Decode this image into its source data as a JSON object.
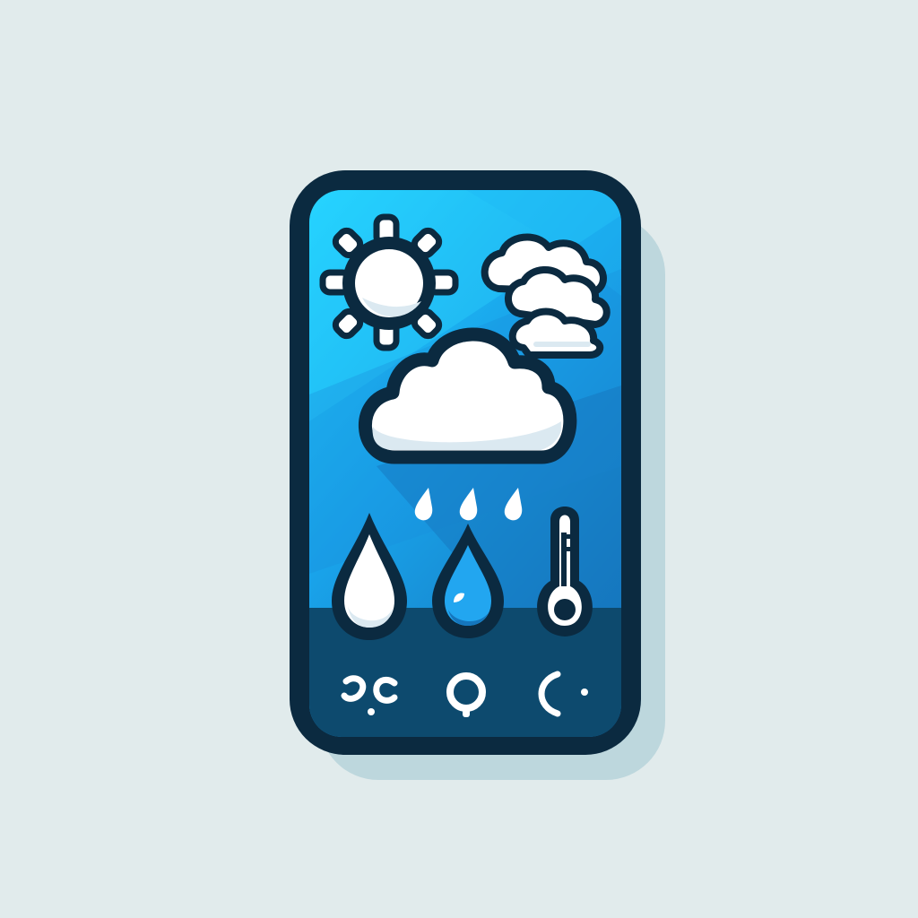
{
  "app_icon": {
    "icons": [
      "sun-icon",
      "cloud-cluster-icon",
      "rain-cloud-icon",
      "raindrop-icon",
      "water-drop-icon",
      "thermometer-icon",
      "wind-swirl-icon",
      "location-pin-icon",
      "crescent-moon-icon"
    ]
  },
  "colors": {
    "background": "#e1ebec",
    "shadow": "#bcd6dc",
    "outline": "#0b2a40",
    "sky_top": "#1fd0ff",
    "sky_mid": "#1a9ae6",
    "sky_deep": "#1770b4",
    "bottom_panel": "#0d4a6e",
    "white": "#ffffff",
    "ice": "#dbe9f1",
    "drop_blue": "#22a6f0"
  }
}
